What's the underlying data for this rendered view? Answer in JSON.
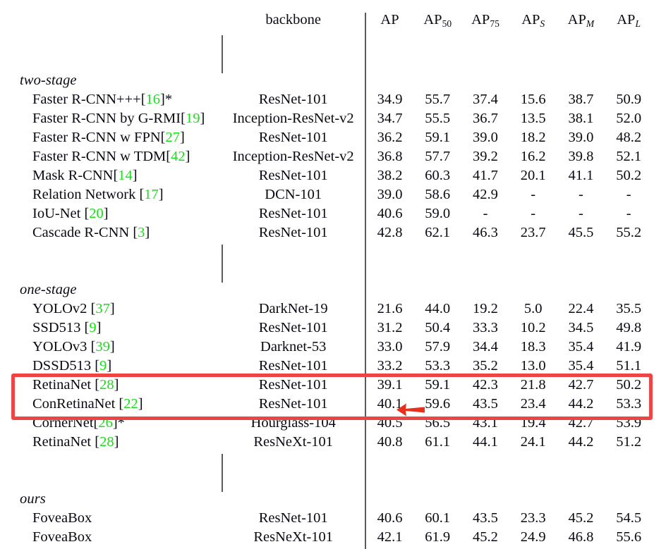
{
  "table": {
    "columns": [
      {
        "key": "method",
        "label": ""
      },
      {
        "key": "backbone",
        "label": "backbone"
      },
      {
        "key": "ap",
        "label": "AP",
        "sub": ""
      },
      {
        "key": "ap50",
        "label": "AP",
        "sub": "50"
      },
      {
        "key": "ap75",
        "label": "AP",
        "sub": "75"
      },
      {
        "key": "aps",
        "label": "AP",
        "sub": "S"
      },
      {
        "key": "apm",
        "label": "AP",
        "sub": "M"
      },
      {
        "key": "apl",
        "label": "AP",
        "sub": "L"
      }
    ],
    "sections": [
      {
        "name": "two-stage",
        "rows": [
          {
            "method": "Faster R-CNN+++",
            "cite": "16",
            "suffix": "]*",
            "prefix": "[",
            "backbone": "ResNet-101",
            "ap": "34.9",
            "ap50": "55.7",
            "ap75": "37.4",
            "aps": "15.6",
            "apm": "38.7",
            "apl": "50.9"
          },
          {
            "method": "Faster R-CNN by G-RMI",
            "cite": "19",
            "suffix": "]",
            "prefix": "[",
            "backbone": "Inception-ResNet-v2",
            "ap": "34.7",
            "ap50": "55.5",
            "ap75": "36.7",
            "aps": "13.5",
            "apm": "38.1",
            "apl": "52.0"
          },
          {
            "method": "Faster R-CNN w FPN",
            "cite": "27",
            "suffix": "]",
            "prefix": "[",
            "backbone": "ResNet-101",
            "ap": "36.2",
            "ap50": "59.1",
            "ap75": "39.0",
            "aps": "18.2",
            "apm": "39.0",
            "apl": "48.2"
          },
          {
            "method": "Faster R-CNN w TDM",
            "cite": "42",
            "suffix": "]",
            "prefix": "[",
            "backbone": "Inception-ResNet-v2",
            "ap": "36.8",
            "ap50": "57.7",
            "ap75": "39.2",
            "aps": "16.2",
            "apm": "39.8",
            "apl": "52.1"
          },
          {
            "method": "Mask R-CNN",
            "cite": "14",
            "suffix": "]",
            "prefix": "[",
            "backbone": "ResNet-101",
            "ap": "38.2",
            "ap50": "60.3",
            "ap75": "41.7",
            "aps": "20.1",
            "apm": "41.1",
            "apl": "50.2"
          },
          {
            "method": "Relation Network ",
            "cite": "17",
            "suffix": "]",
            "prefix": "[",
            "backbone": "DCN-101",
            "ap": "39.0",
            "ap50": "58.6",
            "ap75": "42.9",
            "aps": "-",
            "apm": "-",
            "apl": "-"
          },
          {
            "method": "IoU-Net ",
            "cite": "20",
            "suffix": "]",
            "prefix": "[",
            "backbone": "ResNet-101",
            "ap": "40.6",
            "ap50": "59.0",
            "ap75": "-",
            "aps": "-",
            "apm": "-",
            "apl": "-"
          },
          {
            "method": "Cascade R-CNN ",
            "cite": "3",
            "suffix": "]",
            "prefix": "[",
            "backbone": "ResNet-101",
            "ap": "42.8",
            "ap50": "62.1",
            "ap75": "46.3",
            "aps": "23.7",
            "apm": "45.5",
            "apl": "55.2"
          }
        ]
      },
      {
        "name": "one-stage",
        "rows": [
          {
            "method": "YOLOv2 ",
            "cite": "37",
            "suffix": "]",
            "prefix": "[",
            "backbone": "DarkNet-19",
            "ap": "21.6",
            "ap50": "44.0",
            "ap75": "19.2",
            "aps": "5.0",
            "apm": "22.4",
            "apl": "35.5"
          },
          {
            "method": "SSD513 ",
            "cite": "9",
            "suffix": "]",
            "prefix": "[",
            "backbone": "ResNet-101",
            "ap": "31.2",
            "ap50": "50.4",
            "ap75": "33.3",
            "aps": "10.2",
            "apm": "34.5",
            "apl": "49.8"
          },
          {
            "method": "YOLOv3 ",
            "cite": "39",
            "suffix": "]",
            "prefix": "[",
            "backbone": "Darknet-53",
            "ap": "33.0",
            "ap50": "57.9",
            "ap75": "34.4",
            "aps": "18.3",
            "apm": "35.4",
            "apl": "41.9"
          },
          {
            "method": "DSSD513 ",
            "cite": "9",
            "suffix": "]",
            "prefix": "[",
            "backbone": "ResNet-101",
            "ap": "33.2",
            "ap50": "53.3",
            "ap75": "35.2",
            "aps": "13.0",
            "apm": "35.4",
            "apl": "51.1"
          },
          {
            "method": "RetinaNet ",
            "cite": "28",
            "suffix": "]",
            "prefix": "[",
            "backbone": "ResNet-101",
            "ap": "39.1",
            "ap50": "59.1",
            "ap75": "42.3",
            "aps": "21.8",
            "apm": "42.7",
            "apl": "50.2"
          },
          {
            "method": "ConRetinaNet ",
            "cite": "22",
            "suffix": "]",
            "prefix": "[",
            "backbone": "ResNet-101",
            "ap": "40.1",
            "ap50": "59.6",
            "ap75": "43.5",
            "aps": "23.4",
            "apm": "44.2",
            "apl": "53.3"
          },
          {
            "method": "CornerNet",
            "cite": "26",
            "suffix": "]*",
            "prefix": "[",
            "backbone": "Hourglass-104",
            "ap": "40.5",
            "ap50": "56.5",
            "ap75": "43.1",
            "aps": "19.4",
            "apm": "42.7",
            "apl": "53.9"
          },
          {
            "method": "RetinaNet ",
            "cite": "28",
            "suffix": "]",
            "prefix": "[",
            "backbone": "ResNeXt-101",
            "ap": "40.8",
            "ap50": "61.1",
            "ap75": "44.1",
            "aps": "24.1",
            "apm": "44.2",
            "apl": "51.2"
          }
        ]
      },
      {
        "name": "ours",
        "rows": [
          {
            "method": "FoveaBox",
            "cite": "",
            "suffix": "",
            "prefix": "",
            "backbone": "ResNet-101",
            "ap": "40.6",
            "ap50": "60.1",
            "ap75": "43.5",
            "aps": "23.3",
            "apm": "45.2",
            "apl": "54.5"
          },
          {
            "method": "FoveaBox",
            "cite": "",
            "suffix": "",
            "prefix": "",
            "backbone": "ResNeXt-101",
            "ap": "42.1",
            "ap50": "61.9",
            "ap75": "45.2",
            "aps": "24.9",
            "apm": "46.8",
            "apl": "55.6"
          }
        ]
      }
    ]
  },
  "annotations": {
    "highlight_box_color": "#ef4444",
    "arrow_color": "#e8301f",
    "citation_color": "#16e016",
    "rule_color": "#5a5a5a"
  }
}
